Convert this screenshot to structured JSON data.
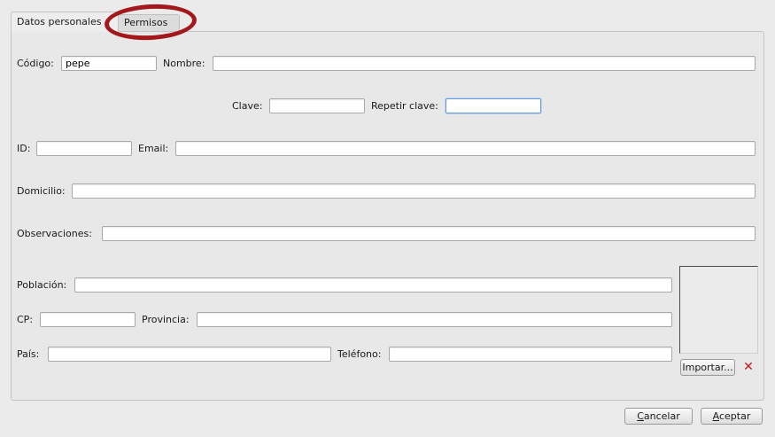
{
  "tabs": {
    "datos_personales": "Datos personales",
    "permisos": "Permisos"
  },
  "fields": {
    "codigo": {
      "label": "Código:",
      "value": "pepe"
    },
    "nombre": {
      "label": "Nombre:",
      "value": ""
    },
    "clave": {
      "label": "Clave:",
      "value": ""
    },
    "repetir_clave": {
      "label": "Repetir clave:",
      "value": ""
    },
    "id": {
      "label": "ID:",
      "value": ""
    },
    "email": {
      "label": "Email:",
      "value": ""
    },
    "domicilio": {
      "label": "Domicilio:",
      "value": ""
    },
    "observaciones": {
      "label": "Observaciones:",
      "value": ""
    },
    "poblacion": {
      "label": "Población:",
      "value": ""
    },
    "cp": {
      "label": "CP:",
      "value": ""
    },
    "provincia": {
      "label": "Provincia:",
      "value": ""
    },
    "pais": {
      "label": "País:",
      "value": ""
    },
    "telefono": {
      "label": "Teléfono:",
      "value": ""
    }
  },
  "photo": {
    "import_label": "Importar...",
    "delete_icon": "close-x-icon",
    "delete_color": "#c0141a"
  },
  "footer": {
    "cancelar_first": "C",
    "cancelar_rest": "ancelar",
    "aceptar_first": "A",
    "aceptar_rest": "ceptar"
  },
  "annotation": {
    "ring_color": "#a3181c"
  }
}
